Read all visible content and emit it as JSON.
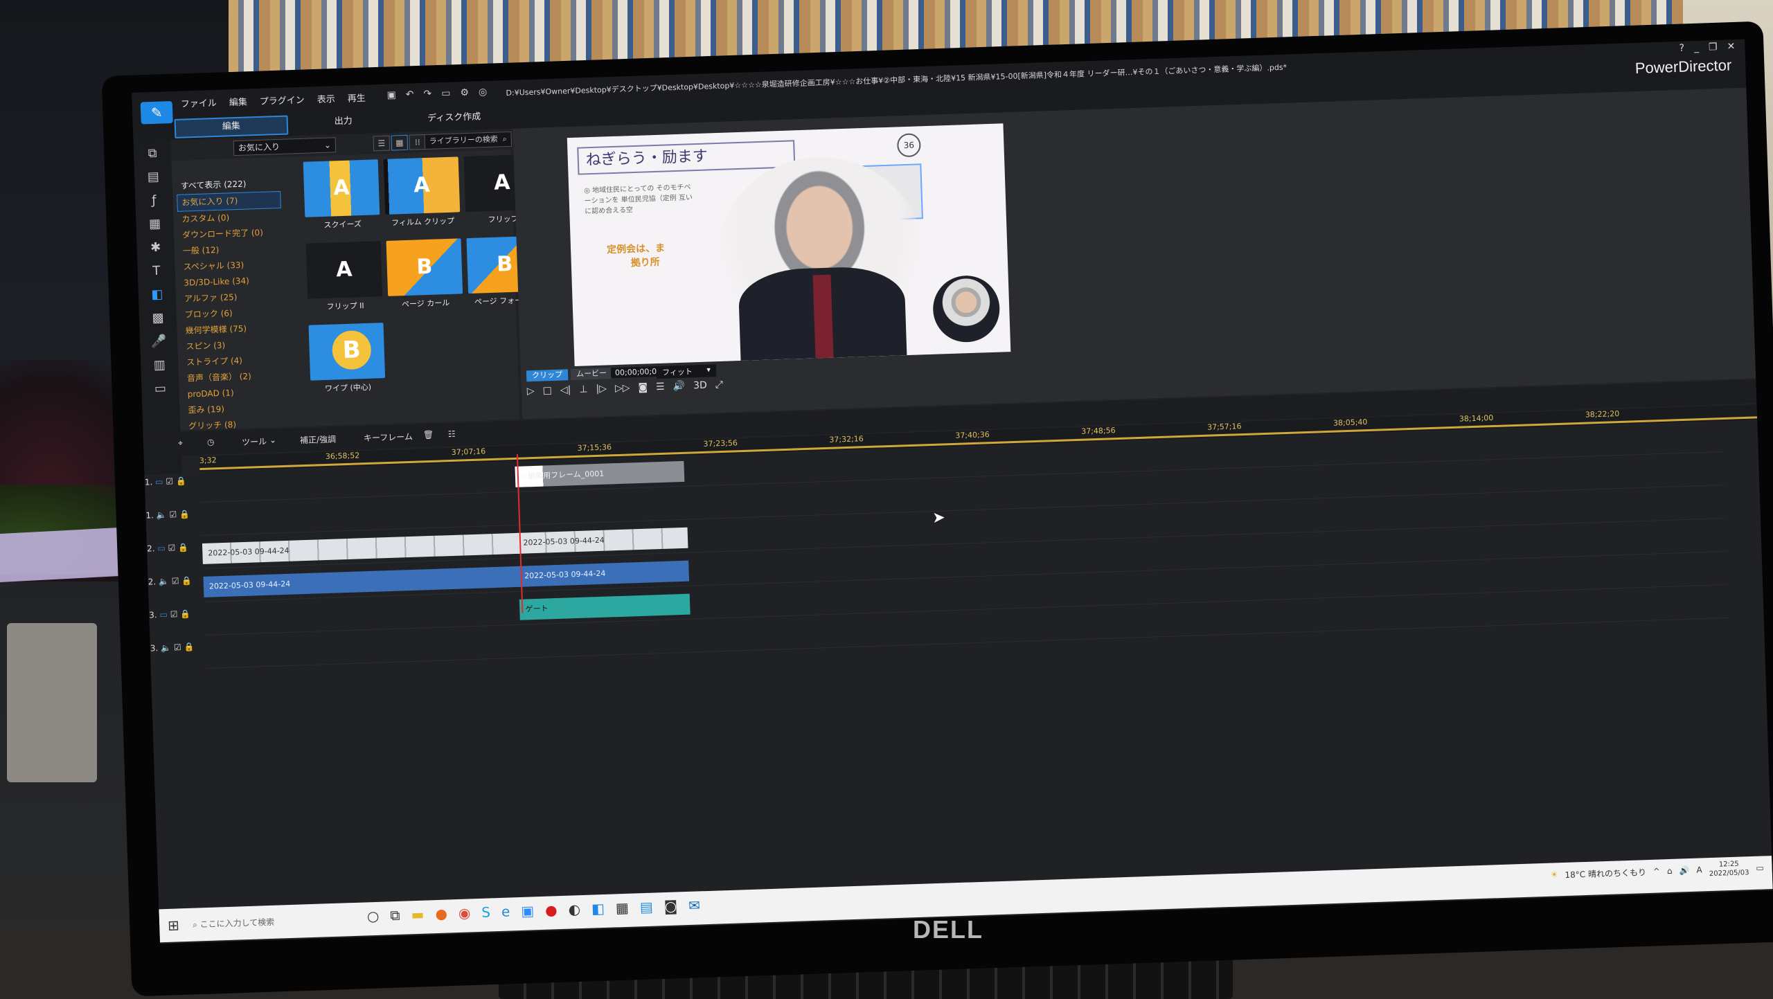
{
  "app": {
    "brand": "PowerDirector",
    "menus": [
      "ファイル",
      "編集",
      "プラグイン",
      "表示",
      "再生"
    ],
    "modes": [
      {
        "label": "編集",
        "active": true
      },
      {
        "label": "出力",
        "active": false
      },
      {
        "label": "ディスク作成",
        "active": false
      }
    ],
    "file_path": "D:¥Users¥Owner¥Desktop¥デスクトップ¥Desktop¥Desktop¥☆☆☆☆泉堀造研修企画工房¥☆☆☆お仕事¥②中部・東海・北陸¥15 新潟県¥15-00[新潟県]令和４年度 リーダー研…¥その１（ごあいさつ・意義・学ぶ編）.pds*",
    "window_controls": [
      "?",
      "_",
      "❐",
      "✕"
    ]
  },
  "library": {
    "filter_label": "お気に入り",
    "search_placeholder": "ライブラリーの検索",
    "categories": [
      {
        "label": "すべて表示 (222)",
        "selected": false
      },
      {
        "label": "お気に入り (7)",
        "selected": true
      },
      {
        "label": "カスタム (0)",
        "selected": false
      },
      {
        "label": "ダウンロード完了 (0)",
        "selected": false
      },
      {
        "label": "一般 (12)",
        "selected": false
      },
      {
        "label": "スペシャル (33)",
        "selected": false
      },
      {
        "label": "3D/3D-Like (34)",
        "selected": false
      },
      {
        "label": "アルファ (25)",
        "selected": false
      },
      {
        "label": "ブロック (6)",
        "selected": false
      },
      {
        "label": "幾何学模様 (75)",
        "selected": false
      },
      {
        "label": "スピン (3)",
        "selected": false
      },
      {
        "label": "ストライプ (4)",
        "selected": false
      },
      {
        "label": "音声（音楽） (2)",
        "selected": false
      },
      {
        "label": "proDAD (1)",
        "selected": false
      },
      {
        "label": "歪み (19)",
        "selected": false
      },
      {
        "label": "グリッチ (8)",
        "selected": false
      }
    ],
    "transitions": [
      {
        "label": "スクイーズ",
        "style": "t-blue",
        "glyph": "A"
      },
      {
        "label": "フィルム クリップ",
        "style": "t-film",
        "glyph": "A"
      },
      {
        "label": "フリップ",
        "style": "t-dark",
        "glyph": "A"
      },
      {
        "label": "フリップ II",
        "style": "t-dark",
        "glyph": "A"
      },
      {
        "label": "ページ カール",
        "style": "t-orange",
        "glyph": "B"
      },
      {
        "label": "ページ フォールド",
        "style": "t-orange2",
        "glyph": "B"
      },
      {
        "label": "ワイプ (中心)",
        "style": "t-circ",
        "glyph": ""
      }
    ]
  },
  "preview": {
    "slide_heading": "ねぎらう・励ます",
    "slide_badge": "36",
    "slide_bullet": "◎ 地域住民にとっての そのモチベーションを 単位民児協（定例 互いに認め合える空",
    "slide_gold_1": "定例会は、ま",
    "slide_gold_2": "拠り所",
    "tabs": [
      {
        "label": "クリップ",
        "active": true
      },
      {
        "label": "ムービー",
        "active": false
      }
    ],
    "timecode": "00;00;00;00",
    "fit": "フィット",
    "controls": [
      "▷",
      "□",
      "◁|",
      "⊥",
      "|▷",
      "▷▷",
      "◙",
      "☰",
      "🔊",
      "3D",
      "⤢"
    ]
  },
  "timeline": {
    "toolbar": {
      "tools": "ツール",
      "fix": "補正/強調",
      "keyframe": "キーフレーム"
    },
    "ruler": [
      "3;32",
      "36;58;52",
      "37;07;16",
      "37;15;36",
      "37;23;56",
      "37;32;16",
      "37;40;36",
      "37;48;56",
      "37;57;16",
      "38;05;40",
      "38;14;00",
      "38;22;20"
    ],
    "tracks": [
      {
        "label": "1.",
        "type": "video",
        "clips": [
          {
            "text": "☆編集用フレーム_0001",
            "kind": "frame",
            "start": 0.207,
            "len": 0.107
          }
        ]
      },
      {
        "label": "1.",
        "type": "audio",
        "clips": []
      },
      {
        "label": "2.",
        "type": "video",
        "clips": [
          {
            "text": "2022-05-03 09-44-24",
            "kind": "video",
            "start": 0.0,
            "len": 0.205
          },
          {
            "text": "2022-05-03 09-44-24",
            "kind": "video",
            "start": 0.207,
            "len": 0.108
          }
        ]
      },
      {
        "label": "2.",
        "type": "audio",
        "clips": [
          {
            "text": "2022-05-03 09-44-24",
            "kind": "audio",
            "start": 0.0,
            "len": 0.205
          },
          {
            "text": "2022-05-03 09-44-24",
            "kind": "audio",
            "start": 0.207,
            "len": 0.108
          }
        ]
      },
      {
        "label": "3.",
        "type": "video",
        "clips": [
          {
            "text": "ゲート",
            "kind": "text",
            "start": 0.207,
            "len": 0.108
          }
        ]
      },
      {
        "label": "3.",
        "type": "audio",
        "clips": []
      }
    ]
  },
  "taskbar": {
    "search_placeholder": "ここに入力して検索",
    "weather": "18°C 晴れのちくもり",
    "time": "12:25",
    "date": "2022/05/03",
    "ime": "A"
  },
  "monitor": {
    "brand": "DELL"
  }
}
